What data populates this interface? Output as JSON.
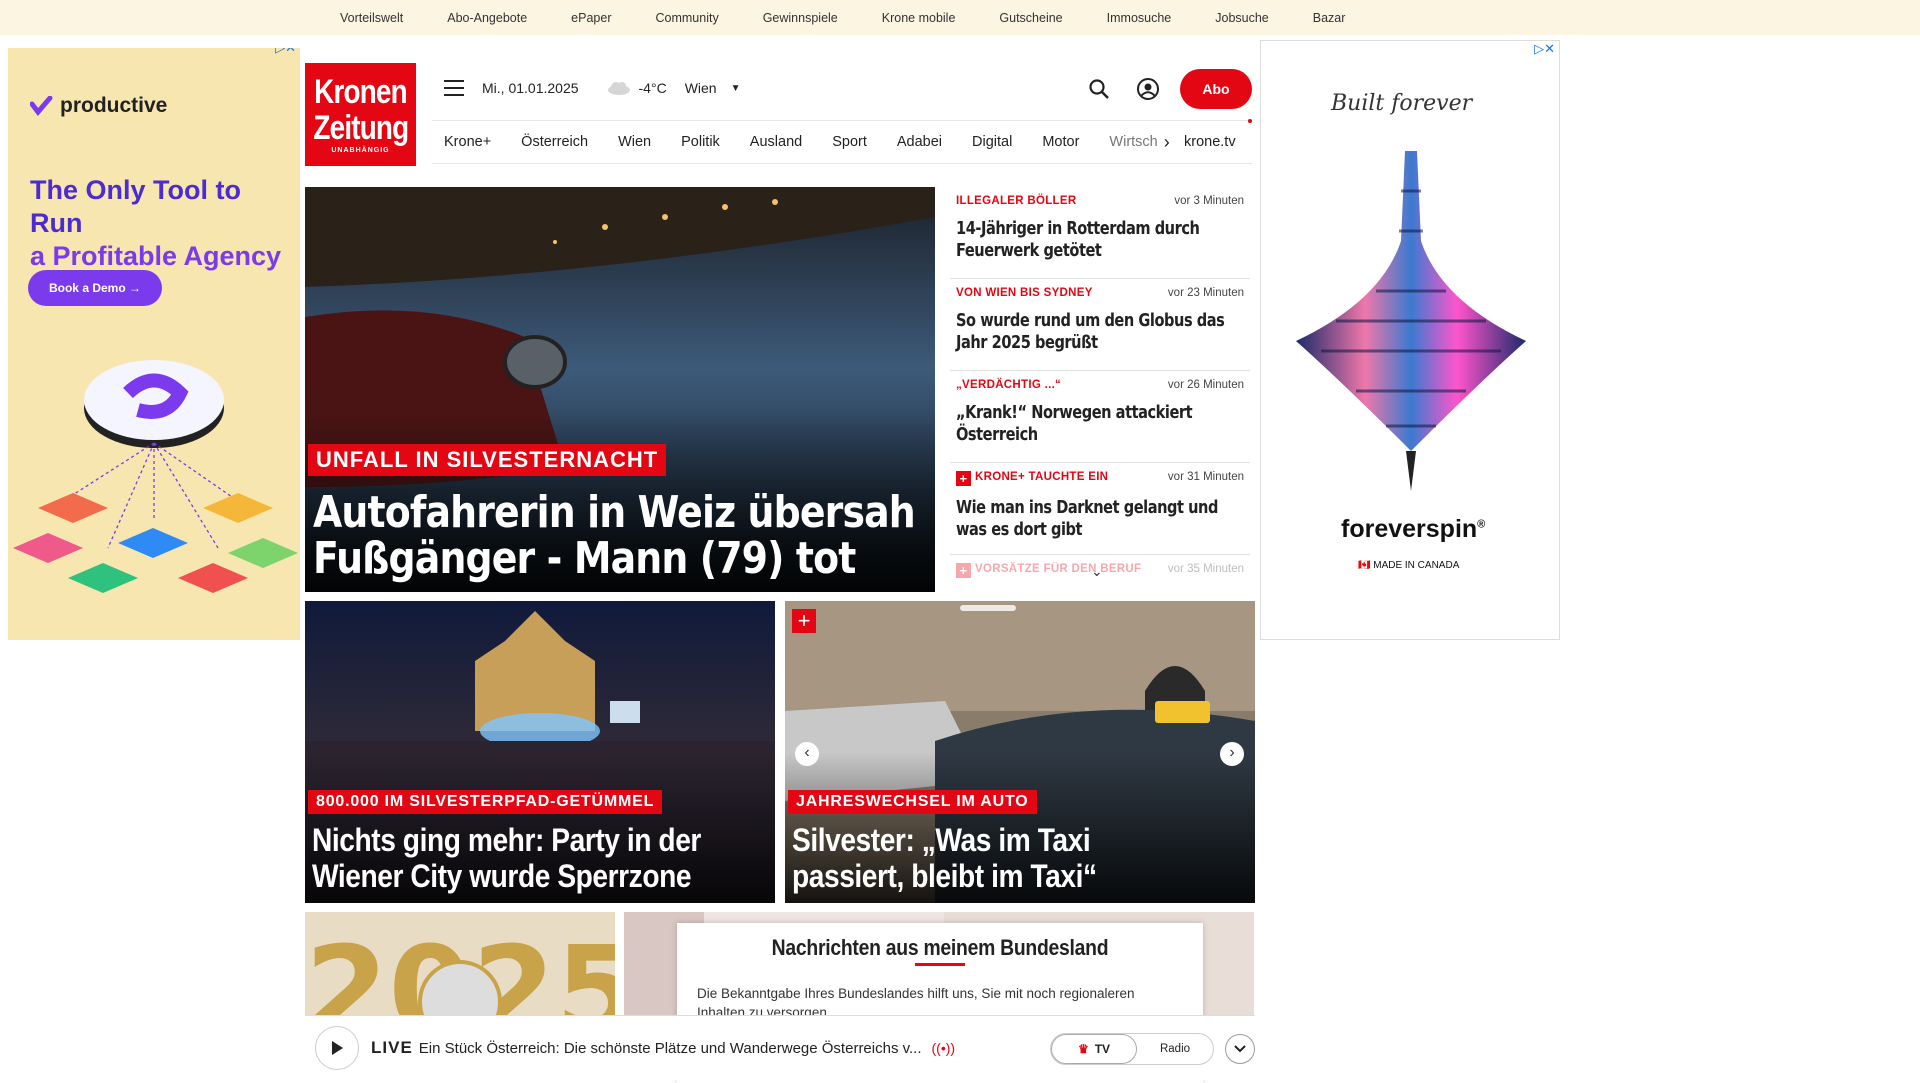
{
  "topnav": [
    "Vorteilswelt",
    "Abo-Angebote",
    "ePaper",
    "Community",
    "Gewinnspiele",
    "Krone mobile",
    "Gutscheine",
    "Immosuche",
    "Jobsuche",
    "Bazar"
  ],
  "logo": {
    "line1": "Kronen",
    "line2": "Zeitung",
    "sub": "UNABHÄNGIG"
  },
  "header": {
    "date": "Mi., 01.01.2025",
    "temp": "-4°C",
    "city": "Wien",
    "abo": "Abo"
  },
  "nav": [
    "Krone+",
    "Österreich",
    "Wien",
    "Politik",
    "Ausland",
    "Sport",
    "Adabei",
    "Digital",
    "Motor",
    "Wirtsch"
  ],
  "nav_extra": "krone.tv",
  "hero": {
    "badge": "UNFALL IN SILVESTERNACHT",
    "title_l1": "Autofahrerin in Weiz übersah",
    "title_l2": "Fußgänger - Mann (79) tot"
  },
  "news": [
    {
      "kicker": "ILLEGALER BÖLLER",
      "time": "vor 3 Minuten",
      "headline": "14-Jähriger in Rotterdam durch Feuerwerk getötet"
    },
    {
      "kicker": "VON WIEN BIS SYDNEY",
      "time": "vor 23 Minuten",
      "headline": "So wurde rund um den Globus das Jahr 2025 begrüßt"
    },
    {
      "kicker": "„VERDÄCHTIG ...“",
      "time": "vor 26 Minuten",
      "headline": "„Krank!“ Norwegen attackiert Österreich"
    },
    {
      "kicker": "KRONE+ TAUCHTE EIN",
      "time": "vor 31 Minuten",
      "headline": "Wie man ins Darknet gelangt und was es dort gibt"
    },
    {
      "kicker": "VORSÄTZE FÜR DEN BERUF",
      "time": "vor 35 Minuten",
      "headline": ""
    }
  ],
  "card1": {
    "badge": "800.000 IM SILVESTERPFAD-GETÜMMEL",
    "title_l1": "Nichts ging mehr: Party in der",
    "title_l2": "Wiener City wurde Sperrzone"
  },
  "card2": {
    "badge": "JAHRESWECHSEL IM AUTO",
    "title_l1": "Silvester: „Was im Taxi",
    "title_l2": "passiert, bleibt im Taxi“"
  },
  "modal": {
    "title": "Nachrichten aus meinem Bundesland",
    "text": "Die Bekanntgabe Ihres Bundeslandes hilft uns, Sie mit noch regionaleren Inhalten zu versorgen."
  },
  "player": {
    "live": "LIVE",
    "title": "Ein Stück Österreich: Die schönste Plätze und Wanderwege Österreichs v...",
    "tv": "TV",
    "radio": "Radio"
  },
  "ad_left": {
    "brand": "productive",
    "headline_l1": "The Only Tool to Run",
    "headline_l2": "a Profitable Agency",
    "button": "Book a Demo →"
  },
  "ad_right": {
    "script": "Built forever",
    "brand": "foreverspin",
    "made": "MADE IN CANADA"
  },
  "colors": {
    "brand_red": "#e30613",
    "topbar": "#fbf5e2",
    "ad_purple": "#7c3aed"
  }
}
